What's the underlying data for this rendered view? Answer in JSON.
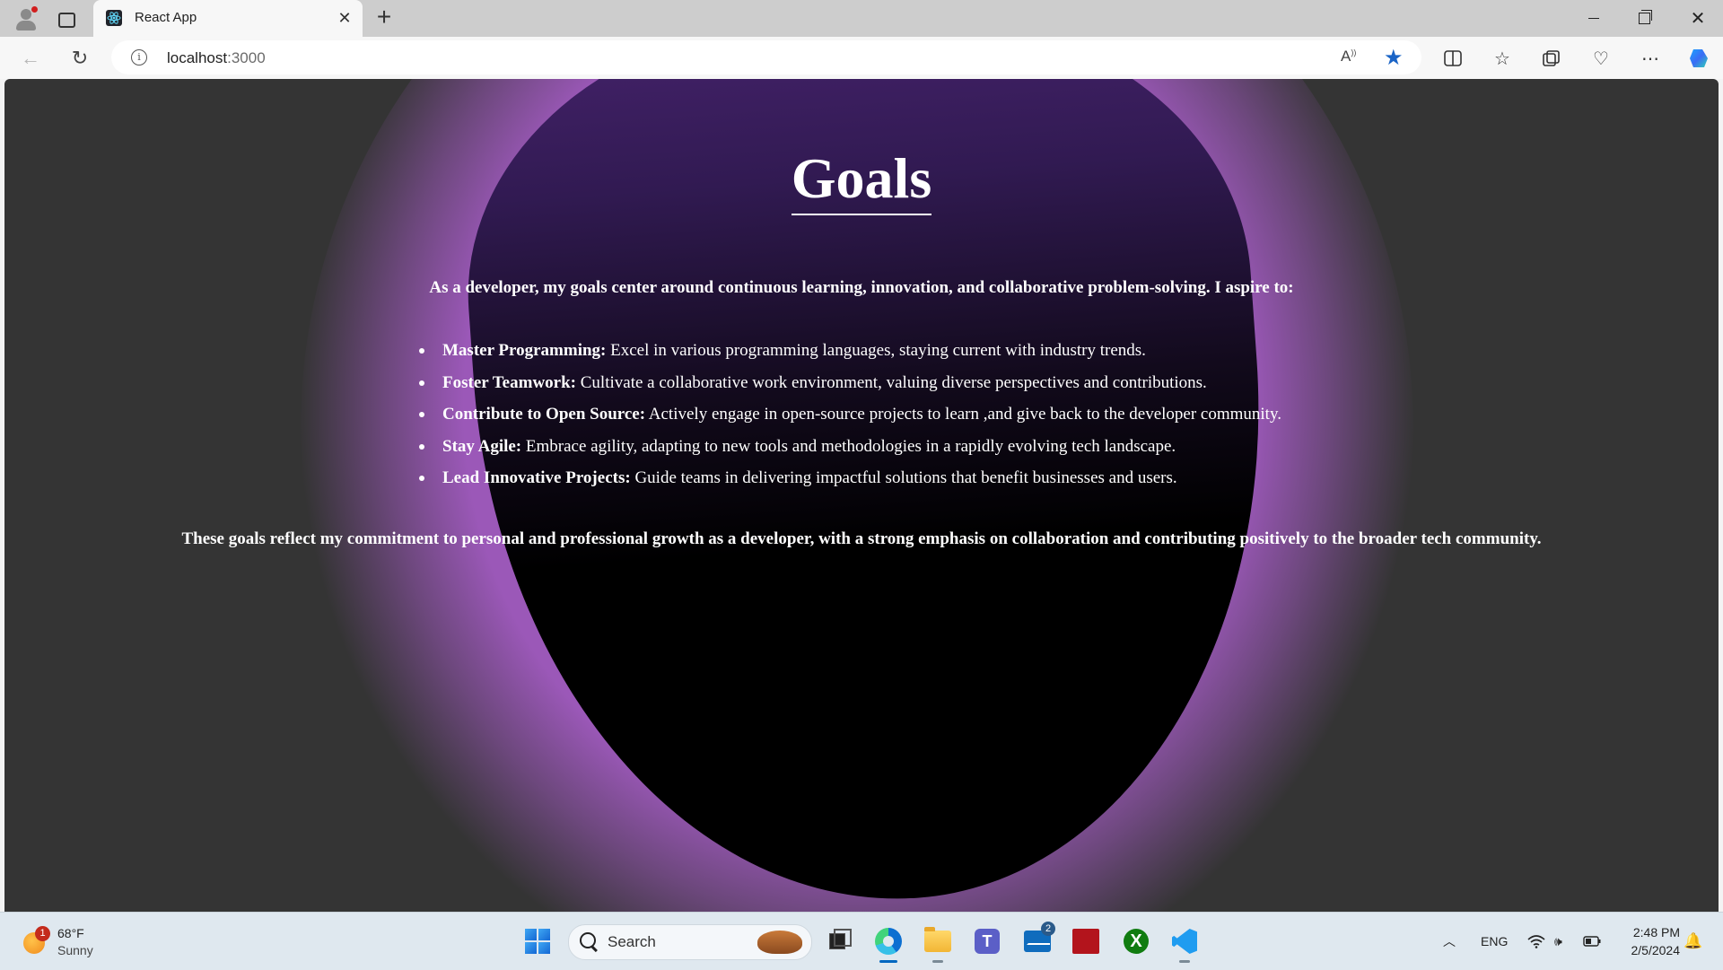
{
  "browser": {
    "tab_title": "React App",
    "tab_close": "✕",
    "new_tab": "+",
    "url_host": "localhost",
    "url_port": ":3000"
  },
  "page": {
    "heading": "Goals",
    "intro": "As a developer, my goals center around continuous learning, innovation, and collaborative problem-solving. I aspire to:",
    "goals": [
      {
        "title": "Master Programming:",
        "text": " Excel in various programming languages, staying current with industry trends."
      },
      {
        "title": "Foster Teamwork:",
        "text": " Cultivate a collaborative work environment, valuing diverse perspectives and contributions."
      },
      {
        "title": "Contribute to Open Source:",
        "text": " Actively engage in open-source projects to learn ,and give back to the developer community."
      },
      {
        "title": "Stay Agile:",
        "text": " Embrace agility, adapting to new tools and methodologies in a rapidly evolving tech landscape."
      },
      {
        "title": "Lead Innovative Projects:",
        "text": " Guide teams in delivering impactful solutions that benefit businesses and users."
      }
    ],
    "outro": "These goals reflect my commitment to personal and professional growth as a developer, with a strong emphasis on collaboration and contributing positively to the broader tech community."
  },
  "taskbar": {
    "weather_badge": "1",
    "weather_temp": "68°F",
    "weather_condition": "Sunny",
    "search_label": "Search",
    "mail_badge": "2",
    "language": "ENG",
    "time": "2:48 PM",
    "date": "2/5/2024"
  },
  "colors": {
    "page_background": "#343434",
    "glow": "#9b58b8",
    "blob_top": "#44226a",
    "blob_bottom": "#000000",
    "bookmark_star": "#1a64c6"
  }
}
